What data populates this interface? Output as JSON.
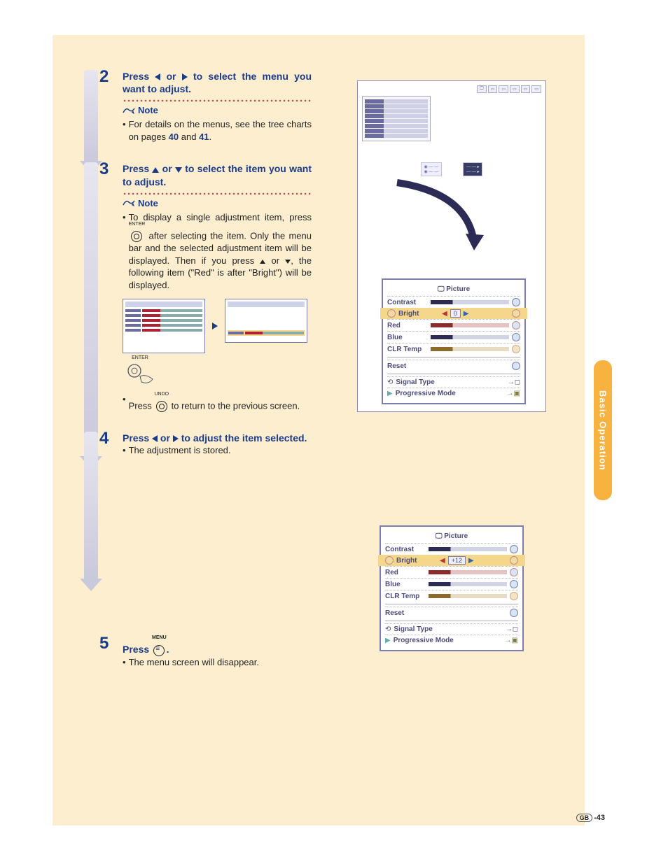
{
  "side_tab": "Basic Operation",
  "page_no": "-43",
  "page_region": "GB",
  "steps": {
    "s2": {
      "num": "2",
      "title_a": "Press ",
      "title_b": " or ",
      "title_c": " to select the menu you want to adjust.",
      "note_label": "Note",
      "bullet_a": "For details on the menus, see the tree charts on pages ",
      "link1": "40",
      "between_links": " and ",
      "link2": "41",
      "bullet_end": "."
    },
    "s3": {
      "num": "3",
      "title_a": "Press ",
      "title_b": " or ",
      "title_c": " to select the item you want to adjust.",
      "note_label": "Note",
      "bullet1_a": "To display a single adjustment item, press ",
      "bullet1_b": " after selecting the item. Only the menu bar and the selected adjustment item will be displayed. Then if you press ",
      "bullet1_c": " or ",
      "bullet1_d": ", the following item (\"Red\" is after \"Bright\") will be displayed.",
      "enter_label": "ENTER",
      "bullet2_a": "Press ",
      "bullet2_b": " to return to the previous screen.",
      "undo_label": "UNDO"
    },
    "s4": {
      "num": "4",
      "title_a": "Press ",
      "title_b": " or ",
      "title_c": " to adjust the item selected.",
      "bullet": "The adjustment is stored."
    },
    "s5": {
      "num": "5",
      "title_a": "Press ",
      "title_b": ".",
      "menu_label": "MENU",
      "bullet": "The menu screen will disappear."
    }
  },
  "osd": {
    "title": "Picture",
    "rows": [
      "Contrast",
      "Bright",
      "Red",
      "Blue",
      "CLR Temp",
      "Reset"
    ],
    "footer": [
      "Signal Type",
      "Progressive Mode"
    ],
    "bright_value": "0",
    "bright_value_adjusted": "+12"
  }
}
